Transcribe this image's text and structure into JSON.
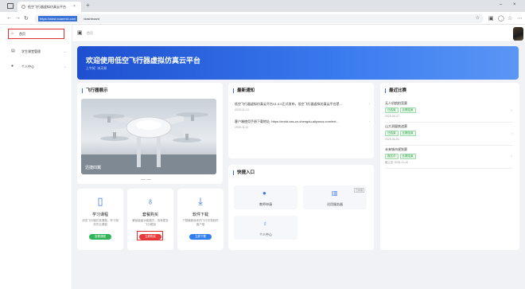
{
  "browser": {
    "tab_title": "低空飞行器虚拟仿真云平台",
    "tab_close": "×",
    "new_tab": "+",
    "url_selected": "https://www.xuanmiu.com",
    "url_rest": "/dashboard",
    "win_min": "–",
    "win_close": "×"
  },
  "sidebar": {
    "items": [
      {
        "label": "首页",
        "icon": "home-icon"
      },
      {
        "label": "学生课堂管理",
        "icon": "document-icon"
      },
      {
        "label": "个人中心",
        "icon": "user-icon"
      }
    ]
  },
  "header": {
    "breadcrumb": "首页"
  },
  "banner": {
    "title": "欢迎使用低空飞行器虚拟仿真云平台",
    "subtitle": "上午好, 冰天如"
  },
  "showcase": {
    "title": "飞行器展示",
    "caption": "迅捷四翼"
  },
  "news": {
    "title": "最新通知",
    "items": [
      {
        "title": "低空飞行器虚拟仿真云平台V1.0.0正式发布。低空飞行器虚拟仿真云平台是...",
        "date": "2025-11-13"
      },
      {
        "title": "客户端使用手册下载地址: https://eruid.oss-cn-chengdu.aliyuncs.com/ext...",
        "date": "2025-11-11"
      }
    ]
  },
  "competitions": {
    "title": "最近比赛",
    "items": [
      {
        "name": "无人机航拍竞赛",
        "tags": [
          "已结束",
          "比赛结束"
        ],
        "date": "2025-09-27"
      },
      {
        "name": "山大测量挑战赛",
        "tags": [
          "已结束",
          "比赛结束"
        ],
        "date": "2025-06-01"
      },
      {
        "name": "未来城市规划赛",
        "tags": [
          "报名中",
          "比赛结束"
        ],
        "date": "截止至 2025-11-10"
      }
    ]
  },
  "quick": {
    "title": "快捷入口",
    "tiles": [
      {
        "label": "教师申请",
        "icon": "person-icon"
      },
      {
        "label": "试用服务器",
        "icon": "building-icon",
        "badge": "已受理"
      },
      {
        "label": "个人中心",
        "icon": "user-icon"
      }
    ]
  },
  "features": [
    {
      "title": "学习课程",
      "desc": "浏览飞行器仿真课程，学习相关作业课程",
      "button": "查看课程",
      "icon": "book-icon"
    },
    {
      "title": "套餐购买",
      "desc": "解锁高级功能模式，探索更多飞行模拟",
      "button": "立即购买",
      "icon": "trophy-icon"
    },
    {
      "title": "软件下载",
      "desc": "下载最新版本的飞行仿真软件客户端",
      "button": "立即下载",
      "icon": "download-icon"
    }
  ]
}
